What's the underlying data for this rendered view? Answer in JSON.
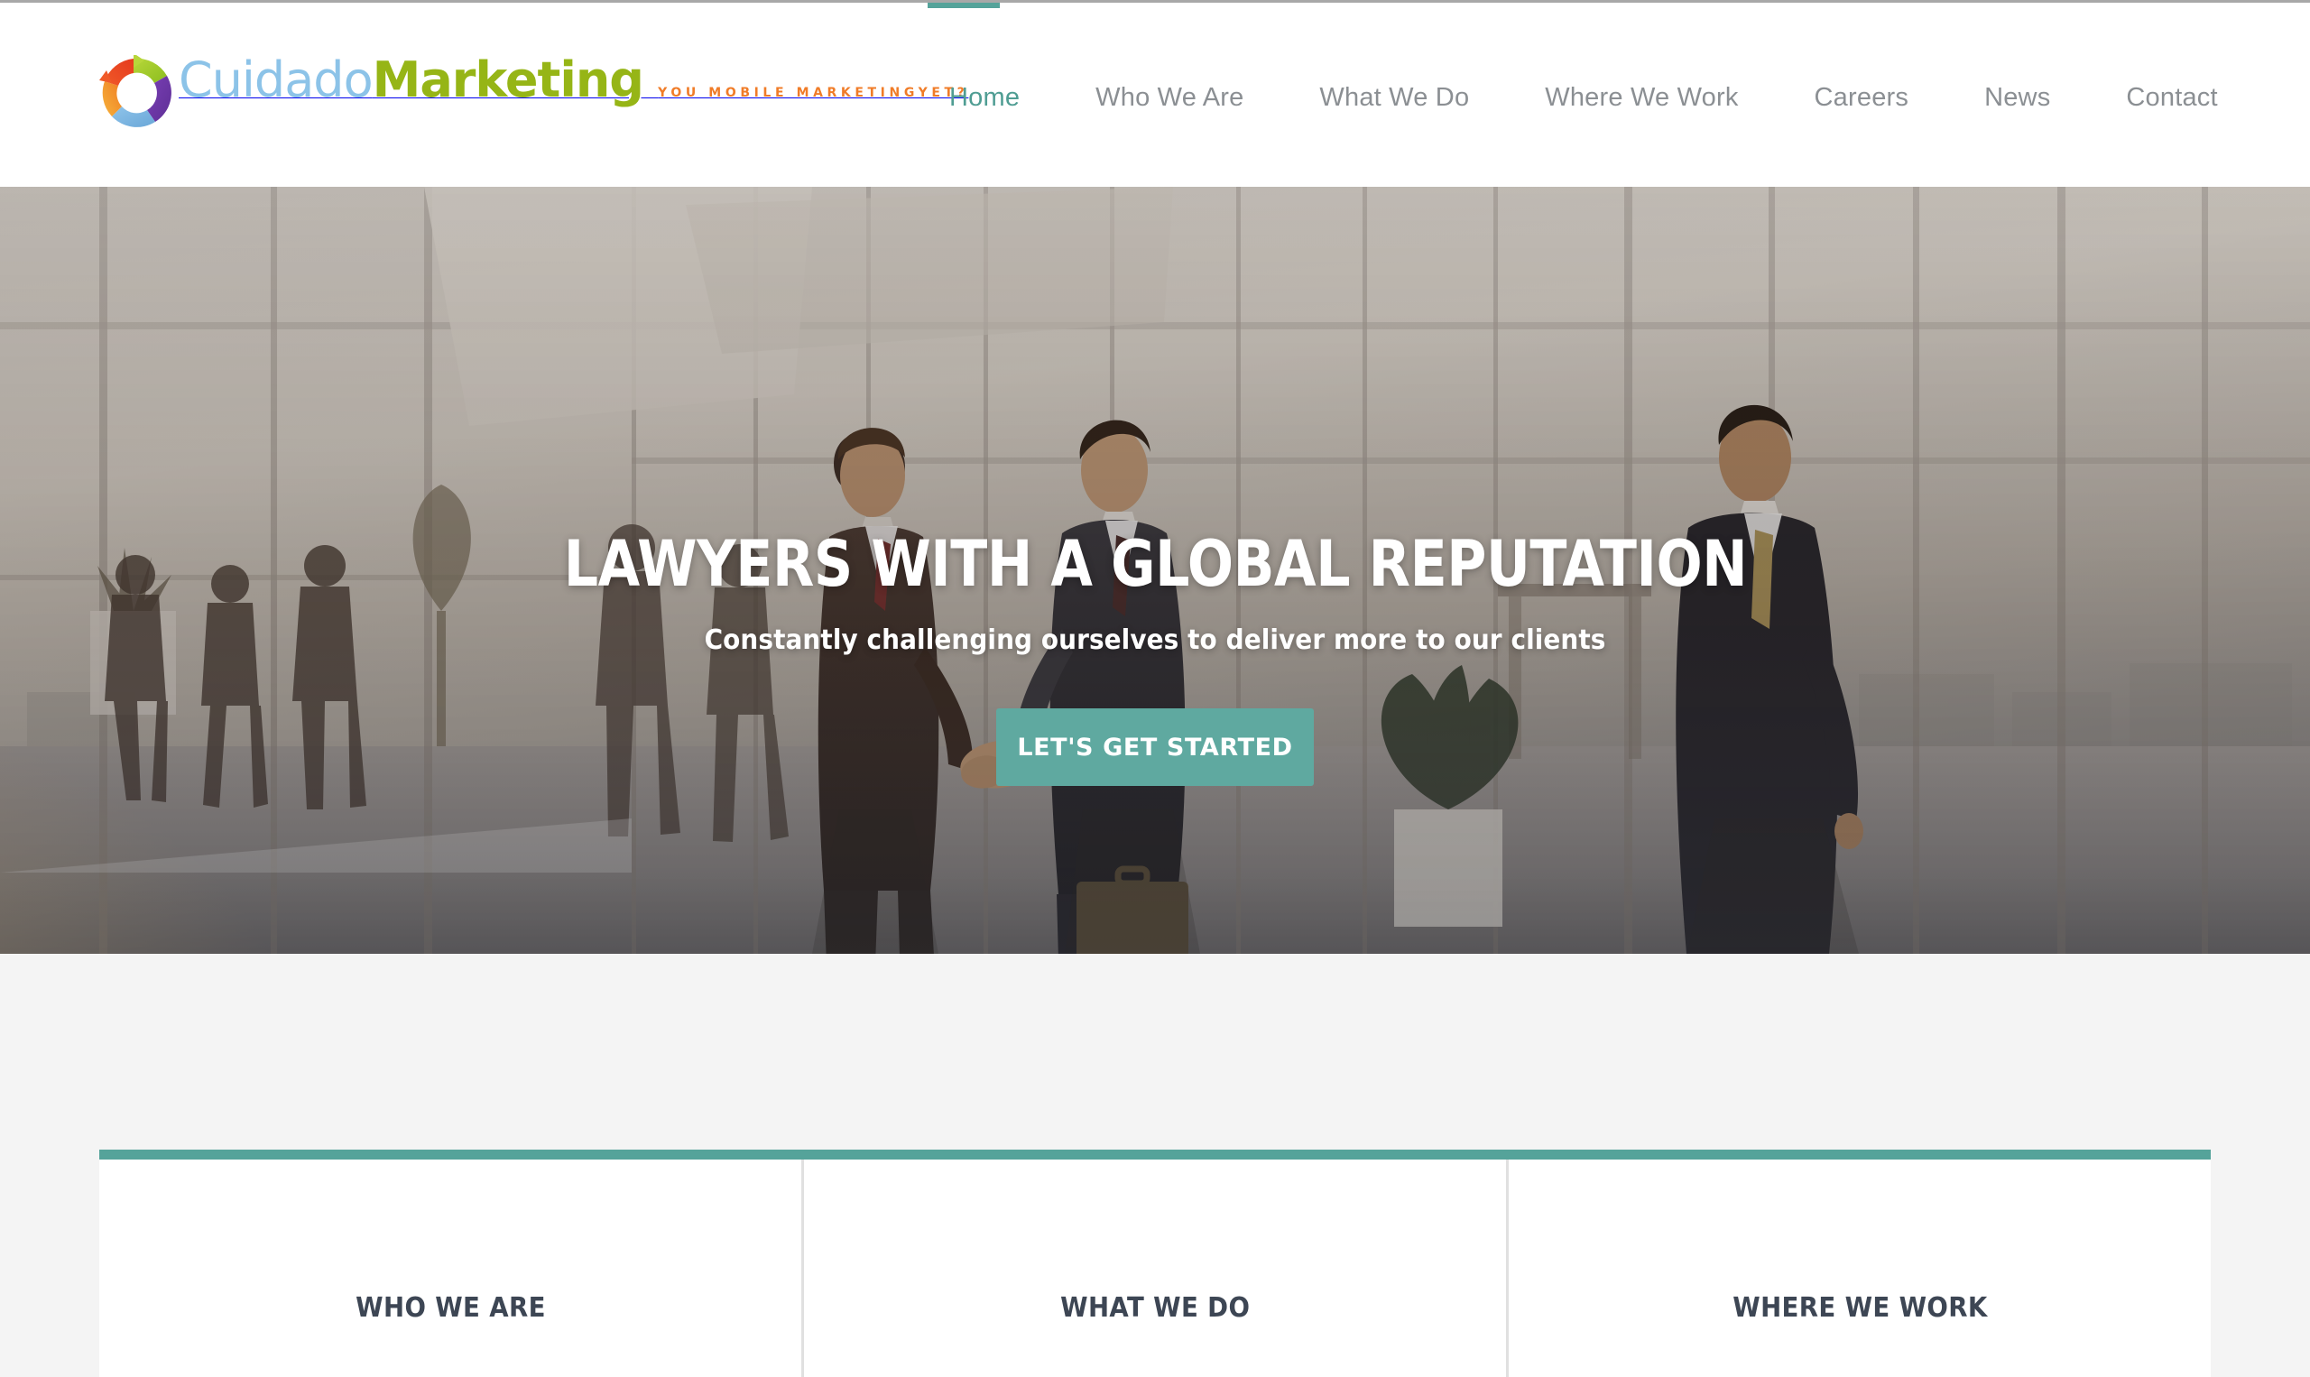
{
  "colors": {
    "accent_teal": "#55a39a",
    "cta_teal": "#5fa9a0",
    "nav_active": "#4f9d93",
    "nav_inactive": "#8b8f93",
    "heading_dark": "#3d4654",
    "section_bg": "#f4f4f4",
    "logo_blue": "#8cc3e8",
    "logo_green": "#96b516",
    "logo_orange": "#f07c28"
  },
  "header": {
    "logo": {
      "icon": "circular-arrows-shutter-icon",
      "word_one": "Cuidado",
      "word_two": "Marketing",
      "tagline": "You Mobile MarketingYet?"
    },
    "nav": [
      {
        "label": "Home",
        "active": true
      },
      {
        "label": "Who We Are",
        "active": false
      },
      {
        "label": "What We Do",
        "active": false
      },
      {
        "label": "Where We Work",
        "active": false
      },
      {
        "label": "Careers",
        "active": false
      },
      {
        "label": "News",
        "active": false
      },
      {
        "label": "Contact",
        "active": false
      }
    ]
  },
  "hero": {
    "title": "LAWYERS WITH A GLOBAL REPUTATION",
    "subtitle": "Constantly challenging ourselves to deliver more to our clients",
    "cta_label": "LET'S GET STARTED",
    "background_image": "office-lobby-business-people-photo"
  },
  "features": {
    "cards": [
      {
        "title": "WHO WE ARE"
      },
      {
        "title": "WHAT WE DO"
      },
      {
        "title": "WHERE WE WORK"
      }
    ]
  }
}
